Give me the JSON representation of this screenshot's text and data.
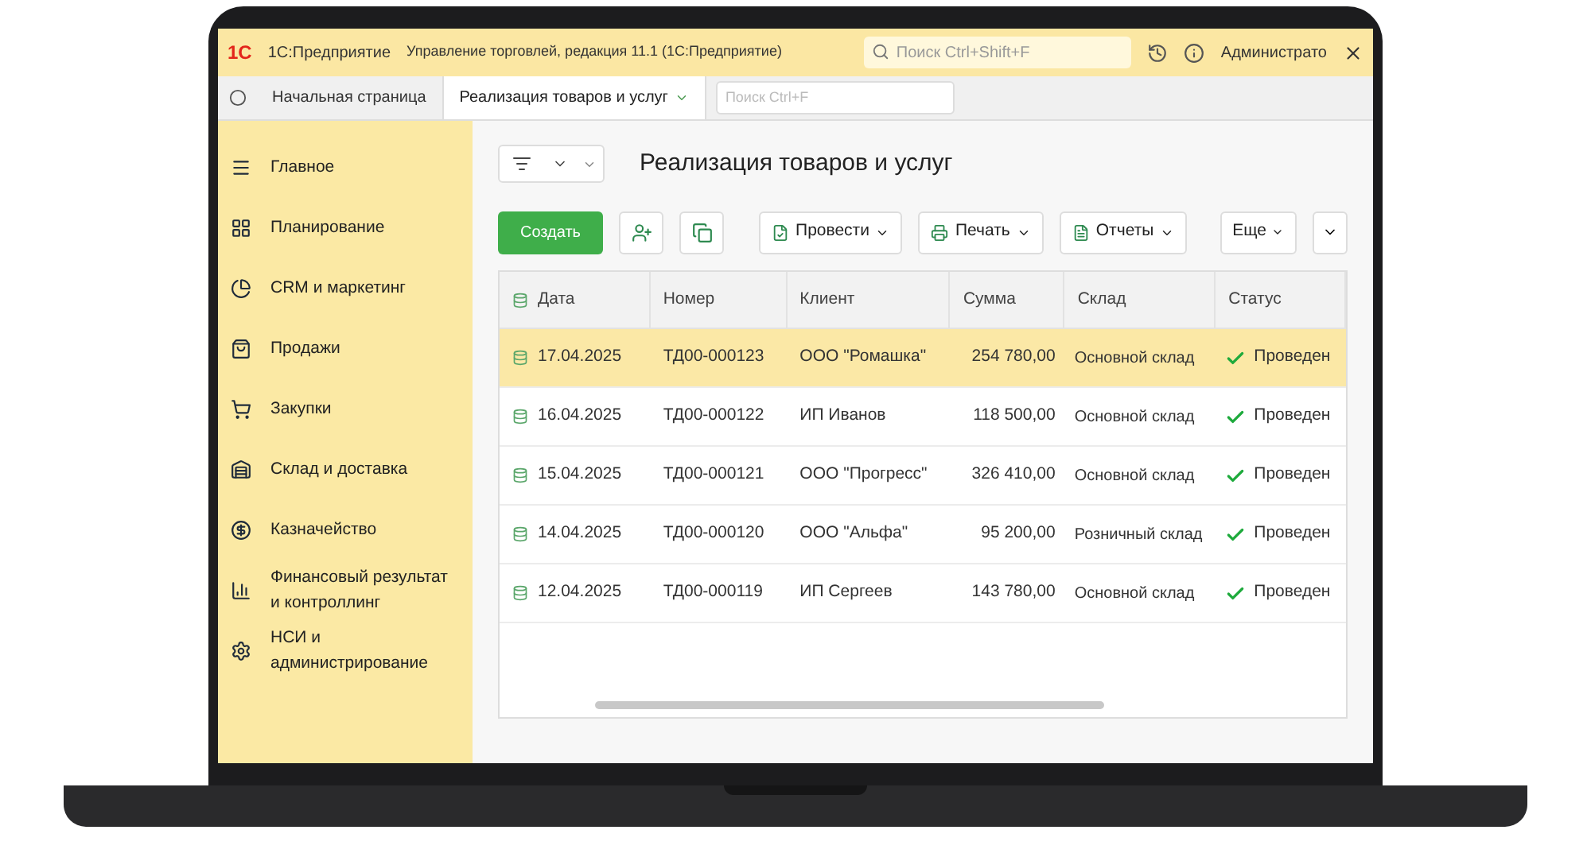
{
  "app": {
    "logo": "1С",
    "name": "1С:Предприятие",
    "title": "Управление торговлей, редакция 11.1 (1С:Предприятие)",
    "search_placeholder": "Поиск Ctrl+Shift+F",
    "user": "Администрато"
  },
  "tabs": [
    {
      "label": "Начальная страница",
      "selected": false
    },
    {
      "label": "Реализация товаров и услуг",
      "selected": true
    }
  ],
  "tab_search_placeholder": "Поиск Ctrl+F",
  "sidebar": {
    "items": [
      {
        "label": "Главное"
      },
      {
        "label": "Планирование"
      },
      {
        "label": "CRM и маркетинг"
      },
      {
        "label": "Продажи"
      },
      {
        "label": "Закупки"
      },
      {
        "label": "Склад и доставка"
      },
      {
        "label": "Казначейство"
      },
      {
        "label": "Финансовый результат и контроллинг"
      },
      {
        "label": "НСИ и администрирование"
      }
    ]
  },
  "form": {
    "title": "Реализация товаров и услуг",
    "buttons": [
      {
        "kind": "primary",
        "label": "Создать"
      },
      {
        "kind": "icon"
      },
      {
        "kind": "icon"
      },
      {
        "kind": "menu",
        "label": "Провести"
      },
      {
        "kind": "menu",
        "label": "Печать"
      },
      {
        "kind": "menu",
        "label": "Отчеты"
      }
    ],
    "more": "Еще"
  },
  "table": {
    "columns": [
      "Дата",
      "Номер",
      "Клиент",
      "Сумма",
      "Склад",
      "Статус"
    ],
    "rows": [
      {
        "date": "17.04.2025",
        "number": "ТД00-000123",
        "client": "ООО \"Ромашка\"",
        "sum": "254 780,00",
        "warehouse": "Основной склад",
        "status": "Проведен",
        "posted": true,
        "selected": true
      },
      {
        "date": "16.04.2025",
        "number": "ТД00-000122",
        "client": "ИП Иванов",
        "sum": "118 500,00",
        "warehouse": "Основной склад",
        "status": "Проведен",
        "posted": true,
        "selected": false
      },
      {
        "date": "15.04.2025",
        "number": "ТД00-000121",
        "client": "ООО \"Прогресс\"",
        "sum": "326 410,00",
        "warehouse": "Основной склад",
        "status": "Проведен",
        "posted": true,
        "selected": false
      },
      {
        "date": "14.04.2025",
        "number": "ТД00-000120",
        "client": "ООО \"Альфа\"",
        "sum": "95 200,00",
        "warehouse": "Розничный склад",
        "status": "Проведен",
        "posted": true,
        "selected": false
      },
      {
        "date": "12.04.2025",
        "number": "ТД00-000119",
        "client": "ИП Сергеев",
        "sum": "143 780,00",
        "warehouse": "Основной склад",
        "status": "Проведен",
        "posted": true,
        "selected": false
      }
    ]
  }
}
